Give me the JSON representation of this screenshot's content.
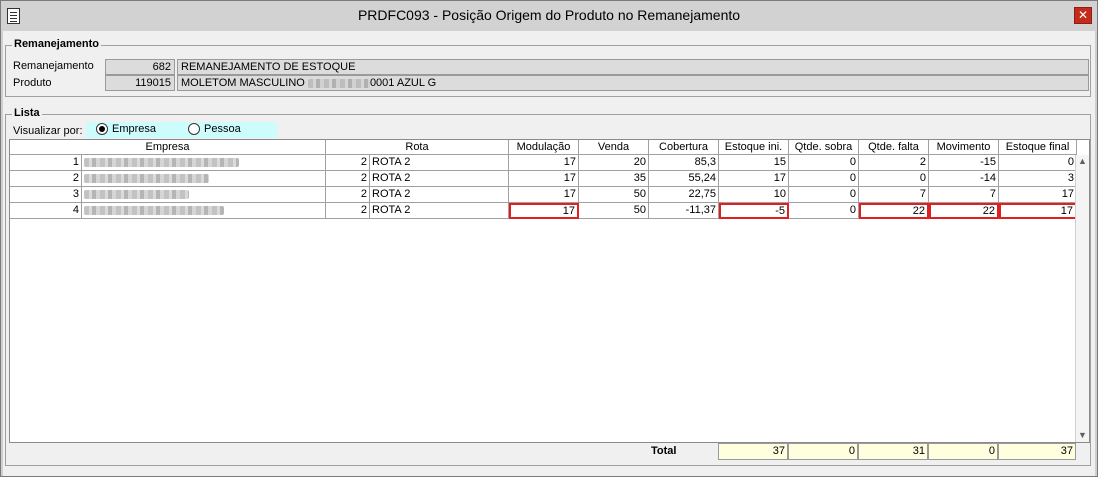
{
  "window": {
    "title": "PRDFC093 - Posição Origem do Produto no Remanejamento",
    "close_glyph": "✕"
  },
  "remanejamento_group": {
    "legend": "Remanejamento",
    "remanejamento_label": "Remanejamento",
    "remanejamento_code": "682",
    "remanejamento_desc": "REMANEJAMENTO DE ESTOQUE",
    "produto_label": "Produto",
    "produto_code": "119015",
    "produto_desc_prefix": "MOLETOM MASCULINO",
    "produto_desc_suffix": "0001 AZUL G"
  },
  "lista_group": {
    "legend": "Lista",
    "visualizar_label": "Visualizar por:",
    "options": [
      {
        "label": "Empresa",
        "selected": true
      },
      {
        "label": "Pessoa",
        "selected": false
      }
    ]
  },
  "grid": {
    "columns": [
      "Empresa",
      "Rota",
      "Modulação",
      "Venda",
      "Cobertura",
      "Estoque ini.",
      "Qtde. sobra",
      "Qtde. falta",
      "Movimento",
      "Estoque final"
    ],
    "rows": [
      {
        "num": "1",
        "rota_num": "2",
        "rota": "ROTA 2",
        "modulacao": "17",
        "venda": "20",
        "cobertura": "85,3",
        "estoque_ini": "15",
        "qtde_sobra": "0",
        "qtde_falta": "2",
        "movimento": "-15",
        "estoque_final": "0"
      },
      {
        "num": "2",
        "rota_num": "2",
        "rota": "ROTA 2",
        "modulacao": "17",
        "venda": "35",
        "cobertura": "55,24",
        "estoque_ini": "17",
        "qtde_sobra": "0",
        "qtde_falta": "0",
        "movimento": "-14",
        "estoque_final": "3"
      },
      {
        "num": "3",
        "rota_num": "2",
        "rota": "ROTA 2",
        "modulacao": "17",
        "venda": "50",
        "cobertura": "22,75",
        "estoque_ini": "10",
        "qtde_sobra": "0",
        "qtde_falta": "7",
        "movimento": "7",
        "estoque_final": "17"
      },
      {
        "num": "4",
        "rota_num": "2",
        "rota": "ROTA 2",
        "modulacao": "17",
        "venda": "50",
        "cobertura": "-11,37",
        "estoque_ini": "-5",
        "qtde_sobra": "0",
        "qtde_falta": "22",
        "movimento": "22",
        "estoque_final": "17"
      }
    ],
    "highlight_color": "#e02020"
  },
  "totals": {
    "label": "Total",
    "estoque_ini": "37",
    "qtde_sobra": "0",
    "qtde_falta": "31",
    "movimento": "0",
    "estoque_final": "37"
  },
  "colors": {
    "radio_bg": "#cdfcfc",
    "total_bg": "#ffffe0",
    "close_bg": "#c42b1c"
  },
  "icons": {
    "app": "document-icon",
    "close": "close-icon",
    "scroll_up": "chevron-up-icon",
    "scroll_down": "chevron-down-icon"
  }
}
